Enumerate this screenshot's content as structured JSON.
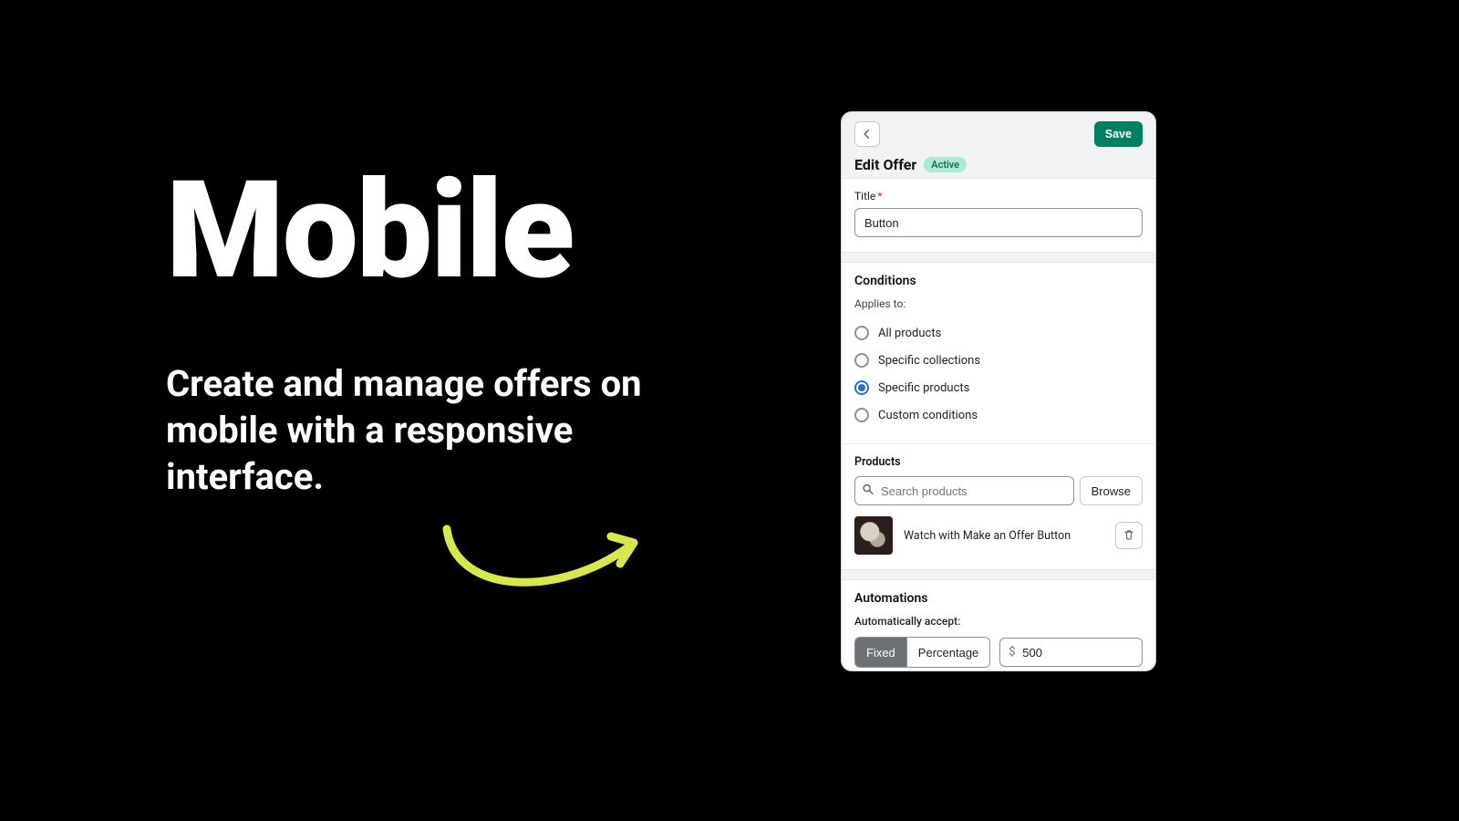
{
  "hero": {
    "title": "Mobile",
    "subtitle": "Create and manage offers on mobile with a responsive interface."
  },
  "header": {
    "page_title": "Edit Offer",
    "badge": "Active",
    "save_label": "Save"
  },
  "title_section": {
    "label": "Title",
    "value": "Button"
  },
  "conditions": {
    "heading": "Conditions",
    "applies_to_label": "Applies to:",
    "options": [
      {
        "label": "All products",
        "selected": false
      },
      {
        "label": "Specific collections",
        "selected": false
      },
      {
        "label": "Specific products",
        "selected": true
      },
      {
        "label": "Custom conditions",
        "selected": false
      }
    ]
  },
  "products": {
    "heading": "Products",
    "search_placeholder": "Search products",
    "browse_label": "Browse",
    "items": [
      {
        "name": "Watch with Make an Offer Button"
      }
    ]
  },
  "automations": {
    "heading": "Automations",
    "accept_label": "Automatically accept:",
    "toggle": {
      "fixed": "Fixed",
      "percentage": "Percentage",
      "active": "fixed"
    },
    "currency_prefix": "$",
    "amount": "500"
  }
}
